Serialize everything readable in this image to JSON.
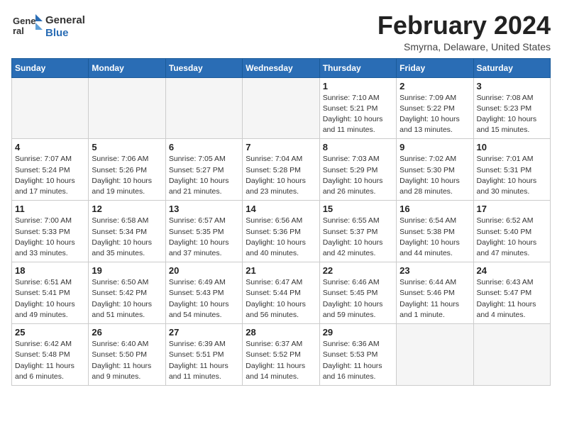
{
  "logo": {
    "text_general": "General",
    "text_blue": "Blue"
  },
  "header": {
    "month_year": "February 2024",
    "location": "Smyrna, Delaware, United States"
  },
  "weekdays": [
    "Sunday",
    "Monday",
    "Tuesday",
    "Wednesday",
    "Thursday",
    "Friday",
    "Saturday"
  ],
  "weeks": [
    [
      {
        "day": "",
        "info": ""
      },
      {
        "day": "",
        "info": ""
      },
      {
        "day": "",
        "info": ""
      },
      {
        "day": "",
        "info": ""
      },
      {
        "day": "1",
        "info": "Sunrise: 7:10 AM\nSunset: 5:21 PM\nDaylight: 10 hours\nand 11 minutes."
      },
      {
        "day": "2",
        "info": "Sunrise: 7:09 AM\nSunset: 5:22 PM\nDaylight: 10 hours\nand 13 minutes."
      },
      {
        "day": "3",
        "info": "Sunrise: 7:08 AM\nSunset: 5:23 PM\nDaylight: 10 hours\nand 15 minutes."
      }
    ],
    [
      {
        "day": "4",
        "info": "Sunrise: 7:07 AM\nSunset: 5:24 PM\nDaylight: 10 hours\nand 17 minutes."
      },
      {
        "day": "5",
        "info": "Sunrise: 7:06 AM\nSunset: 5:26 PM\nDaylight: 10 hours\nand 19 minutes."
      },
      {
        "day": "6",
        "info": "Sunrise: 7:05 AM\nSunset: 5:27 PM\nDaylight: 10 hours\nand 21 minutes."
      },
      {
        "day": "7",
        "info": "Sunrise: 7:04 AM\nSunset: 5:28 PM\nDaylight: 10 hours\nand 23 minutes."
      },
      {
        "day": "8",
        "info": "Sunrise: 7:03 AM\nSunset: 5:29 PM\nDaylight: 10 hours\nand 26 minutes."
      },
      {
        "day": "9",
        "info": "Sunrise: 7:02 AM\nSunset: 5:30 PM\nDaylight: 10 hours\nand 28 minutes."
      },
      {
        "day": "10",
        "info": "Sunrise: 7:01 AM\nSunset: 5:31 PM\nDaylight: 10 hours\nand 30 minutes."
      }
    ],
    [
      {
        "day": "11",
        "info": "Sunrise: 7:00 AM\nSunset: 5:33 PM\nDaylight: 10 hours\nand 33 minutes."
      },
      {
        "day": "12",
        "info": "Sunrise: 6:58 AM\nSunset: 5:34 PM\nDaylight: 10 hours\nand 35 minutes."
      },
      {
        "day": "13",
        "info": "Sunrise: 6:57 AM\nSunset: 5:35 PM\nDaylight: 10 hours\nand 37 minutes."
      },
      {
        "day": "14",
        "info": "Sunrise: 6:56 AM\nSunset: 5:36 PM\nDaylight: 10 hours\nand 40 minutes."
      },
      {
        "day": "15",
        "info": "Sunrise: 6:55 AM\nSunset: 5:37 PM\nDaylight: 10 hours\nand 42 minutes."
      },
      {
        "day": "16",
        "info": "Sunrise: 6:54 AM\nSunset: 5:38 PM\nDaylight: 10 hours\nand 44 minutes."
      },
      {
        "day": "17",
        "info": "Sunrise: 6:52 AM\nSunset: 5:40 PM\nDaylight: 10 hours\nand 47 minutes."
      }
    ],
    [
      {
        "day": "18",
        "info": "Sunrise: 6:51 AM\nSunset: 5:41 PM\nDaylight: 10 hours\nand 49 minutes."
      },
      {
        "day": "19",
        "info": "Sunrise: 6:50 AM\nSunset: 5:42 PM\nDaylight: 10 hours\nand 51 minutes."
      },
      {
        "day": "20",
        "info": "Sunrise: 6:49 AM\nSunset: 5:43 PM\nDaylight: 10 hours\nand 54 minutes."
      },
      {
        "day": "21",
        "info": "Sunrise: 6:47 AM\nSunset: 5:44 PM\nDaylight: 10 hours\nand 56 minutes."
      },
      {
        "day": "22",
        "info": "Sunrise: 6:46 AM\nSunset: 5:45 PM\nDaylight: 10 hours\nand 59 minutes."
      },
      {
        "day": "23",
        "info": "Sunrise: 6:44 AM\nSunset: 5:46 PM\nDaylight: 11 hours\nand 1 minute."
      },
      {
        "day": "24",
        "info": "Sunrise: 6:43 AM\nSunset: 5:47 PM\nDaylight: 11 hours\nand 4 minutes."
      }
    ],
    [
      {
        "day": "25",
        "info": "Sunrise: 6:42 AM\nSunset: 5:48 PM\nDaylight: 11 hours\nand 6 minutes."
      },
      {
        "day": "26",
        "info": "Sunrise: 6:40 AM\nSunset: 5:50 PM\nDaylight: 11 hours\nand 9 minutes."
      },
      {
        "day": "27",
        "info": "Sunrise: 6:39 AM\nSunset: 5:51 PM\nDaylight: 11 hours\nand 11 minutes."
      },
      {
        "day": "28",
        "info": "Sunrise: 6:37 AM\nSunset: 5:52 PM\nDaylight: 11 hours\nand 14 minutes."
      },
      {
        "day": "29",
        "info": "Sunrise: 6:36 AM\nSunset: 5:53 PM\nDaylight: 11 hours\nand 16 minutes."
      },
      {
        "day": "",
        "info": ""
      },
      {
        "day": "",
        "info": ""
      }
    ]
  ]
}
